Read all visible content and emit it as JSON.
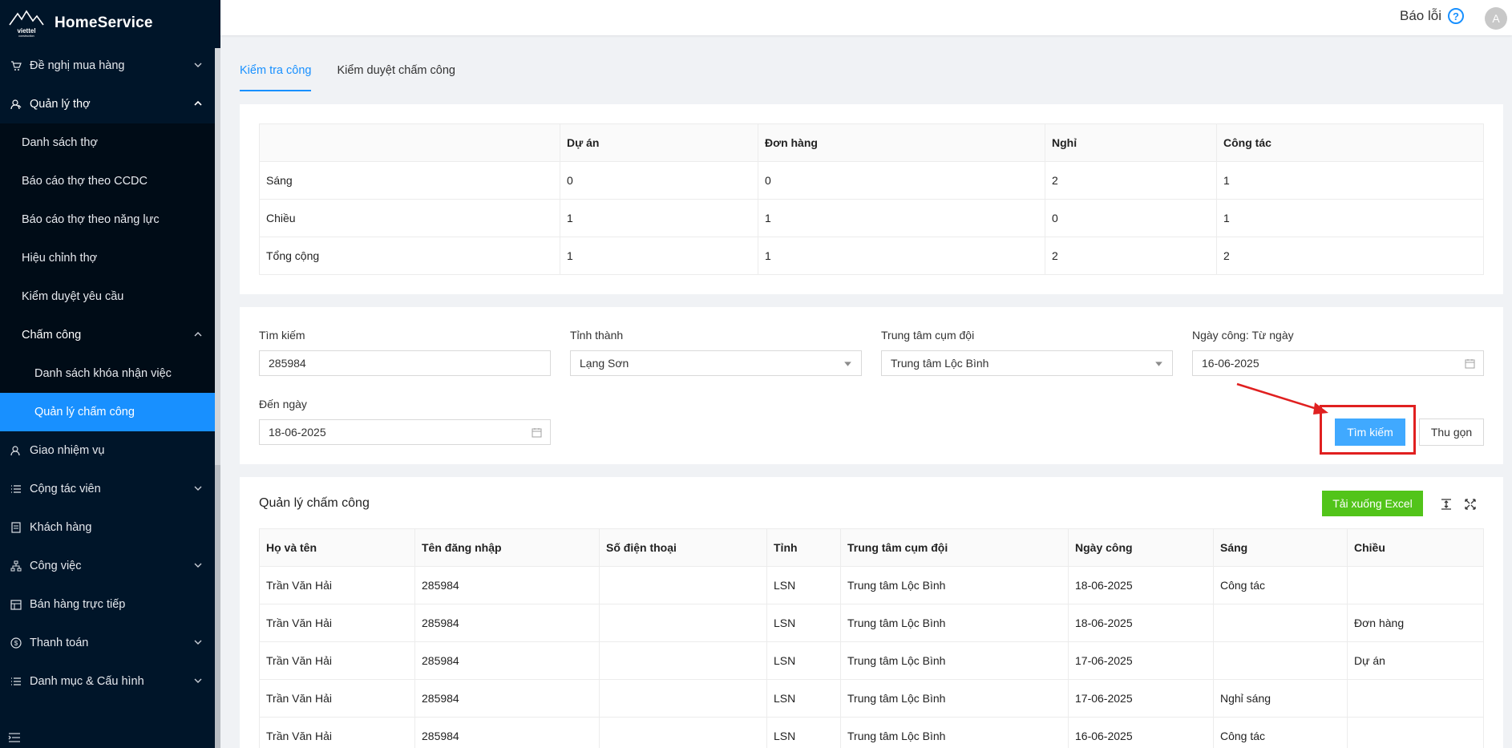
{
  "app": {
    "name": "HomeService",
    "logo_text": "viettel construction"
  },
  "header": {
    "report_label": "Báo lỗi",
    "avatar_initial": "A"
  },
  "sidebar": {
    "items": [
      {
        "label": "Đề nghị mua hàng",
        "icon": "cart-icon"
      },
      {
        "label": "Quản lý thợ",
        "icon": "user-icon"
      },
      {
        "label": "Danh sách thợ"
      },
      {
        "label": "Báo cáo thợ theo CCDC"
      },
      {
        "label": "Báo cáo thợ theo năng lực"
      },
      {
        "label": "Hiệu chỉnh thợ"
      },
      {
        "label": "Kiểm duyệt yêu cầu"
      },
      {
        "label": "Chấm công"
      },
      {
        "label": "Danh sách khóa nhận việc"
      },
      {
        "label": "Quản lý chấm công"
      },
      {
        "label": "Giao nhiệm vụ",
        "icon": "user-icon"
      },
      {
        "label": "Cộng tác viên",
        "icon": "list-icon"
      },
      {
        "label": "Khách hàng",
        "icon": "document-icon"
      },
      {
        "label": "Công việc",
        "icon": "hierarchy-icon"
      },
      {
        "label": "Bán hàng trực tiếp",
        "icon": "shop-icon"
      },
      {
        "label": "Thanh toán",
        "icon": "dollar-icon"
      },
      {
        "label": "Danh mục & Cấu hình",
        "icon": "list-icon"
      }
    ]
  },
  "tabs": [
    {
      "label": "Kiểm tra công"
    },
    {
      "label": "Kiểm duyệt chấm công"
    }
  ],
  "summary": {
    "headers": [
      "",
      "Dự án",
      "Đơn hàng",
      "Nghỉ",
      "Công tác"
    ],
    "rows": [
      [
        "Sáng",
        "0",
        "0",
        "2",
        "1"
      ],
      [
        "Chiều",
        "1",
        "1",
        "0",
        "1"
      ],
      [
        "Tổng cộng",
        "1",
        "1",
        "2",
        "2"
      ]
    ]
  },
  "filter": {
    "search_label": "Tìm kiếm",
    "search_value": "285984",
    "province_label": "Tỉnh thành",
    "province_value": "Lạng Sơn",
    "center_label": "Trung tâm cụm đội",
    "center_value": "Trung tâm Lộc Bình",
    "from_label": "Ngày công: Từ ngày",
    "from_value": "16-06-2025",
    "to_label": "Đến ngày",
    "to_value": "18-06-2025",
    "search_button": "Tìm kiếm",
    "collapse_button": "Thu gọn"
  },
  "records": {
    "title": "Quản lý chấm công",
    "export_button": "Tải xuống Excel",
    "headers": [
      "Họ và tên",
      "Tên đăng nhập",
      "Số điện thoại",
      "Tỉnh",
      "Trung tâm cụm đội",
      "Ngày công",
      "Sáng",
      "Chiều"
    ],
    "rows": [
      [
        "Trần Văn Hải",
        "285984",
        "",
        "LSN",
        "Trung tâm Lộc Bình",
        "18-06-2025",
        "Công tác",
        ""
      ],
      [
        "Trần Văn Hải",
        "285984",
        "",
        "LSN",
        "Trung tâm Lộc Bình",
        "18-06-2025",
        "",
        "Đơn hàng"
      ],
      [
        "Trần Văn Hải",
        "285984",
        "",
        "LSN",
        "Trung tâm Lộc Bình",
        "17-06-2025",
        "",
        "Dự án"
      ],
      [
        "Trần Văn Hải",
        "285984",
        "",
        "LSN",
        "Trung tâm Lộc Bình",
        "17-06-2025",
        "Nghỉ sáng",
        ""
      ],
      [
        "Trần Văn Hải",
        "285984",
        "",
        "LSN",
        "Trung tâm Lộc Bình",
        "16-06-2025",
        "Công tác",
        ""
      ]
    ]
  },
  "colors": {
    "sidebar_bg": "#001529",
    "primary": "#1890ff",
    "export_green": "#52c41a",
    "annotation_red": "#e02020"
  }
}
